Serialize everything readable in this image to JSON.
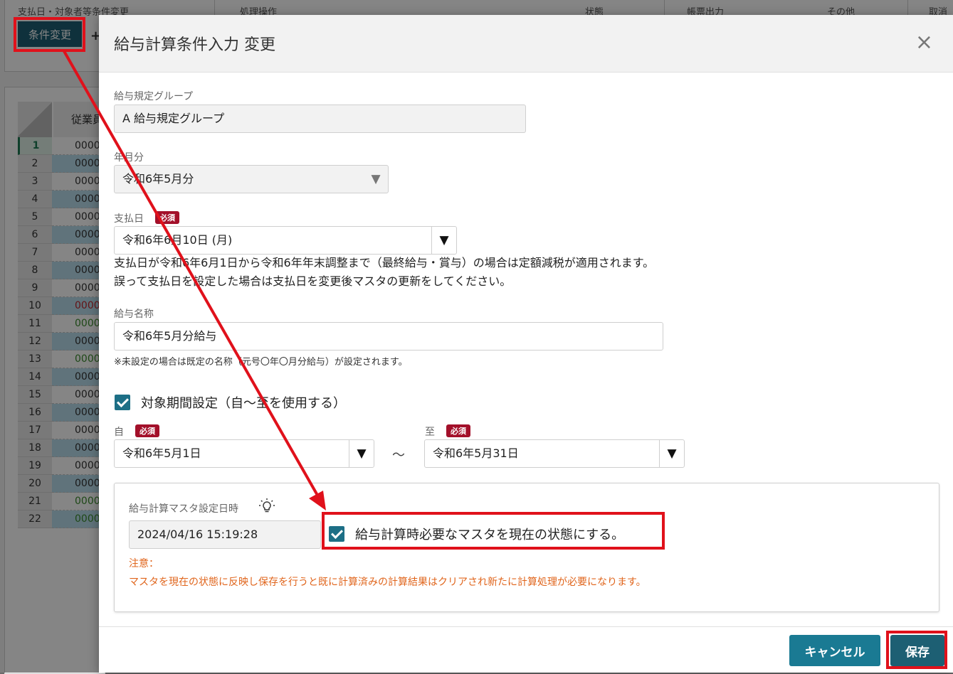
{
  "background": {
    "toolbar_groups": [
      "支払日・対象者等条件変更",
      "処理操作",
      "状態",
      "帳票出力",
      "その他",
      "取消"
    ],
    "condition_change_button": "条件変更",
    "grid_header": "従業員",
    "rows": [
      {
        "num": "1",
        "val": "0000"
      },
      {
        "num": "2",
        "val": "0000"
      },
      {
        "num": "3",
        "val": "0000"
      },
      {
        "num": "4",
        "val": "0000"
      },
      {
        "num": "5",
        "val": "0000"
      },
      {
        "num": "6",
        "val": "0000"
      },
      {
        "num": "7",
        "val": "0000"
      },
      {
        "num": "8",
        "val": "0000"
      },
      {
        "num": "9",
        "val": "0000"
      },
      {
        "num": "10",
        "val": "0000"
      },
      {
        "num": "11",
        "val": "0000"
      },
      {
        "num": "12",
        "val": "0000"
      },
      {
        "num": "13",
        "val": "0000"
      },
      {
        "num": "14",
        "val": "0000"
      },
      {
        "num": "15",
        "val": "0000"
      },
      {
        "num": "16",
        "val": "0000"
      },
      {
        "num": "17",
        "val": "0000"
      },
      {
        "num": "18",
        "val": "0000"
      },
      {
        "num": "19",
        "val": "0000"
      },
      {
        "num": "20",
        "val": "0000"
      },
      {
        "num": "21",
        "val": "0000"
      },
      {
        "num": "22",
        "val": "0000"
      }
    ]
  },
  "modal": {
    "title": "給与計算条件入力 変更",
    "close": "×",
    "required": "必須",
    "group": {
      "label": "給与規定グループ",
      "value": "A 給与規定グループ"
    },
    "month": {
      "label": "年月分",
      "value": "令和6年5月分"
    },
    "paydate": {
      "label": "支払日",
      "value": "令和6年6月10日 (月)",
      "note1": "支払日が令和6年6月1日から令和6年年末調整まで（最終給与・賞与）の場合は定額減税が適用されます。",
      "note2": "誤って支払日を設定した場合は支払日を変更後マスタの更新をしてください。"
    },
    "name": {
      "label": "給与名称",
      "value": "令和6年5月分給与",
      "note": "※未設定の場合は既定の名称（元号〇年〇月分給与）が設定されます。"
    },
    "period": {
      "checkbox_label": "対象期間設定（自～至を使用する）",
      "from_label": "自",
      "from_value": "令和6年5月1日",
      "tilde": "～",
      "to_label": "至",
      "to_value": "令和6年5月31日"
    },
    "master": {
      "label": "給与計算マスタ設定日時",
      "value": "2024/04/16 15:19:28",
      "checkbox_label": "給与計算時必要なマスタを現在の状態にする。",
      "warn_title": "注意：",
      "warn_text": "マスタを現在の状態に反映し保存を行うと既に計算済みの計算結果はクリアされ新たに計算処理が必要になります。"
    },
    "buttons": {
      "cancel": "キャンセル",
      "save": "保存"
    }
  },
  "colors": {
    "accent": "#1a7a93",
    "highlight": "#e0111b",
    "required": "#a3102a",
    "warning": "#e0651c"
  }
}
